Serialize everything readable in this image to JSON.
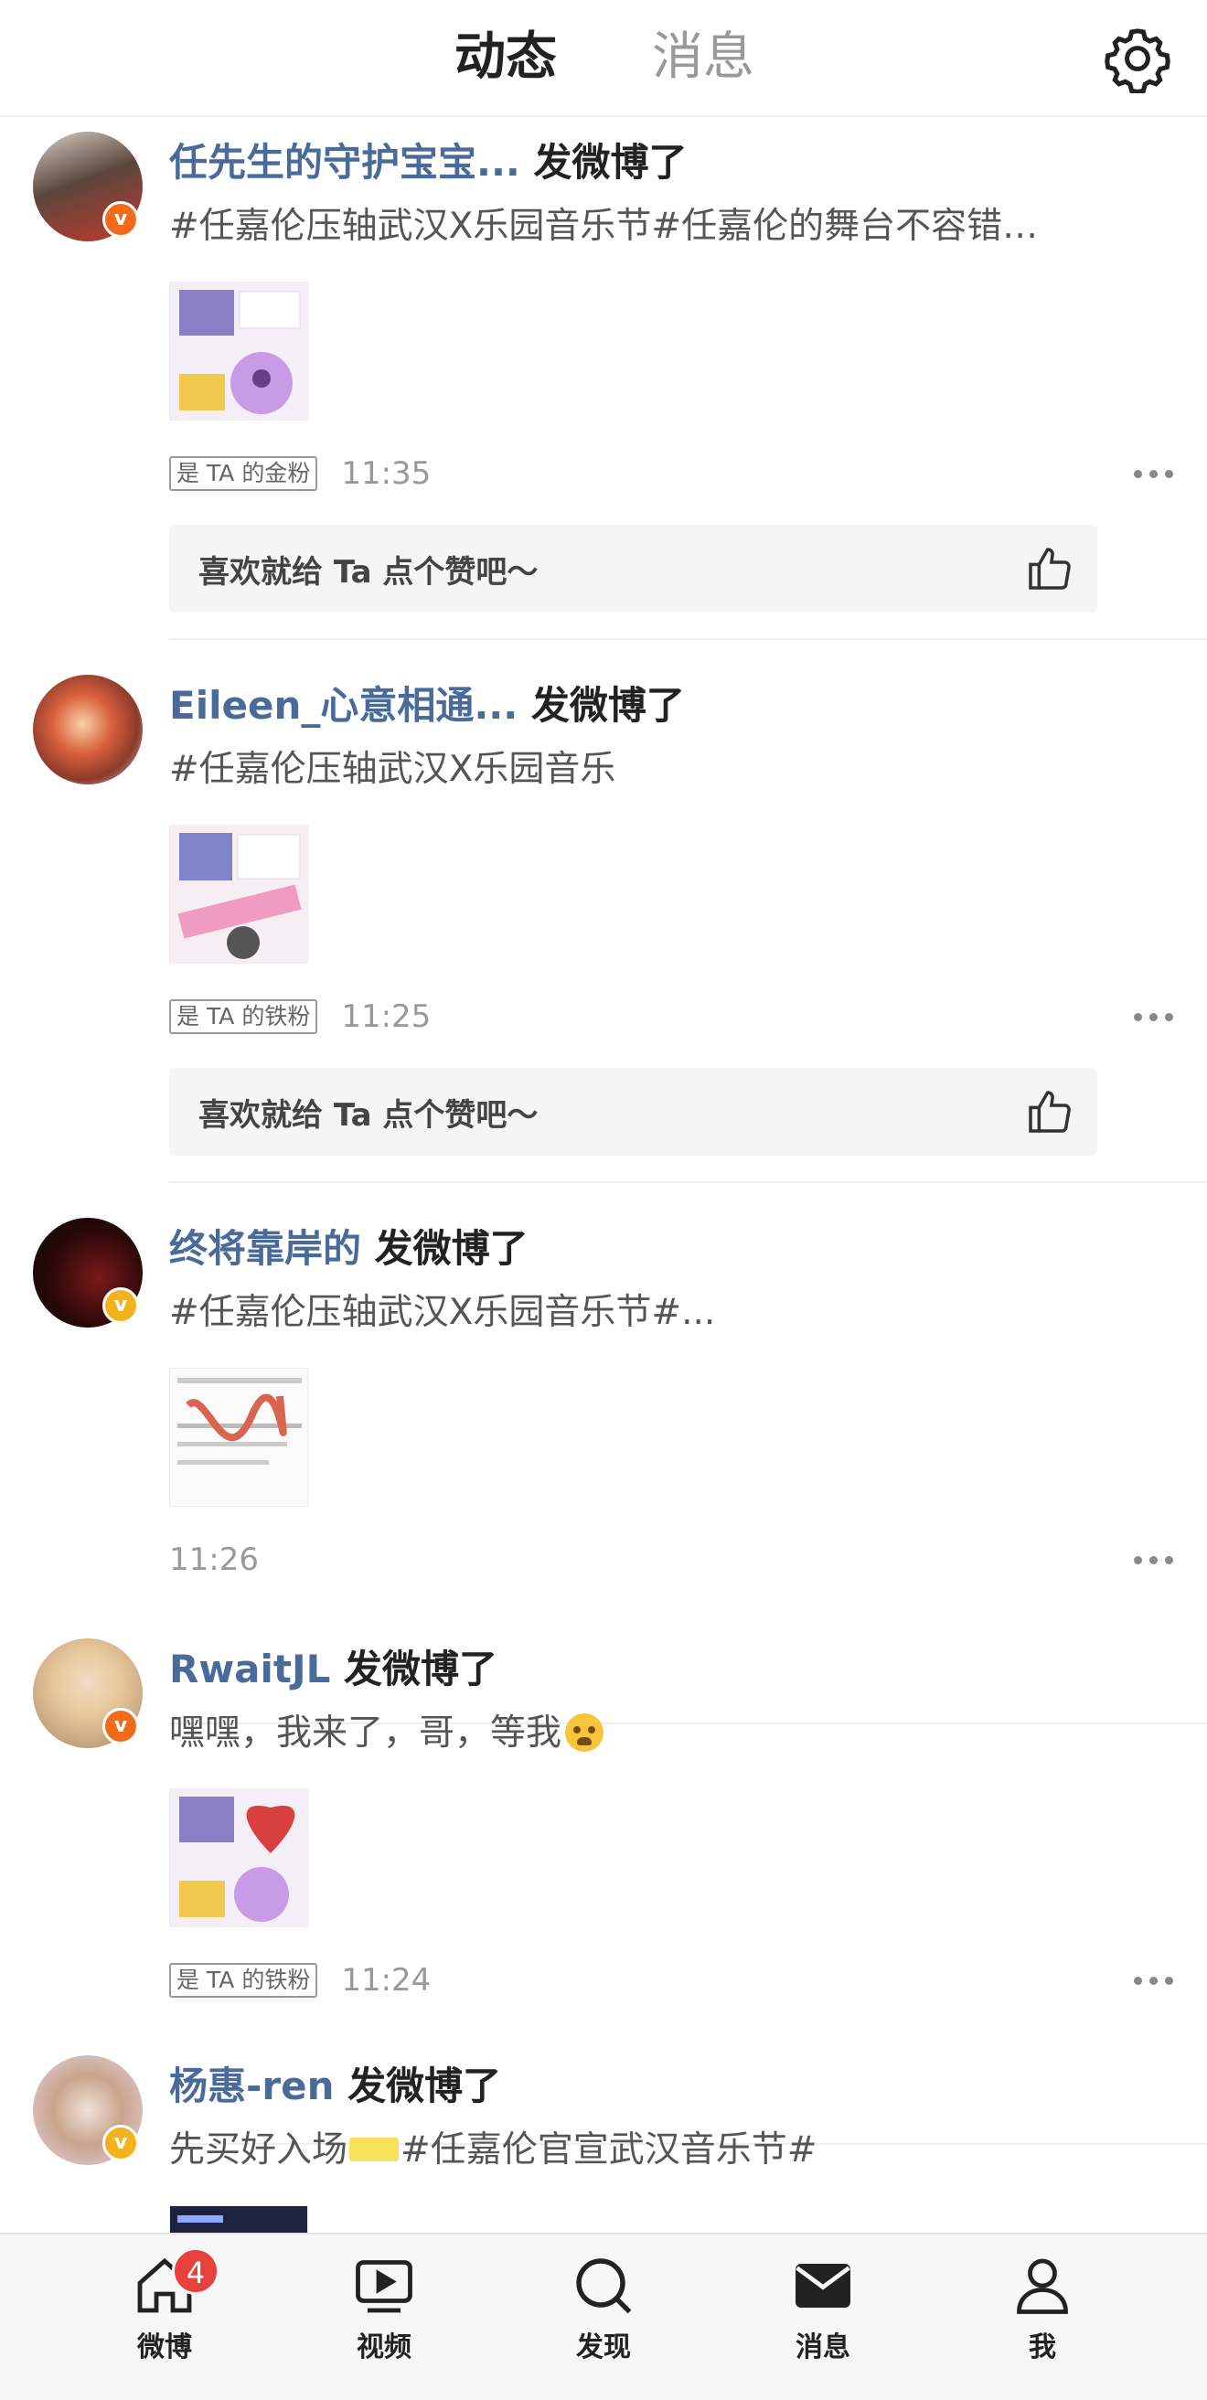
{
  "header": {
    "tabs": [
      {
        "label": "动态",
        "active": true
      },
      {
        "label": "消息",
        "active": false
      }
    ],
    "settings_icon": "gear-icon",
    "accent_color": "#f5a623"
  },
  "posts": [
    {
      "username": "任先生的守护宝宝...",
      "action": " 发微博了",
      "text": "#任嘉伦压轴武汉X乐园音乐节#任嘉伦的舞台不容错…",
      "badge": "是 TA 的金粉",
      "time": "11:35",
      "like_prompt": "喜欢就给 Ta 点个赞吧～"
    },
    {
      "username": "Eileen_心意相通...",
      "action": " 发微博了",
      "text": "#任嘉伦压轴武汉X乐园音乐",
      "badge": "是 TA 的铁粉",
      "time": "11:25",
      "like_prompt": "喜欢就给 Ta 点个赞吧～"
    },
    {
      "username": "终将靠岸的",
      "action": " 发微博了",
      "text": "#任嘉伦压轴武汉X乐园音乐节#...",
      "time": "11:26"
    },
    {
      "username": "RwaitJL",
      "action": " 发微博了",
      "text": "嘿嘿，我来了，哥，等我",
      "badge": "是 TA 的铁粉",
      "time": "11:24"
    },
    {
      "username": "杨惠-ren",
      "action": " 发微博了",
      "text_before": "先买好入场",
      "text_after": "#任嘉伦官宣武汉音乐节#"
    }
  ],
  "tabbar": {
    "items": [
      {
        "label": "微博",
        "icon": "home-icon",
        "badge": "4"
      },
      {
        "label": "视频",
        "icon": "video-icon"
      },
      {
        "label": "发现",
        "icon": "search-icon"
      },
      {
        "label": "消息",
        "icon": "mail-icon"
      },
      {
        "label": "我",
        "icon": "profile-icon"
      }
    ]
  }
}
